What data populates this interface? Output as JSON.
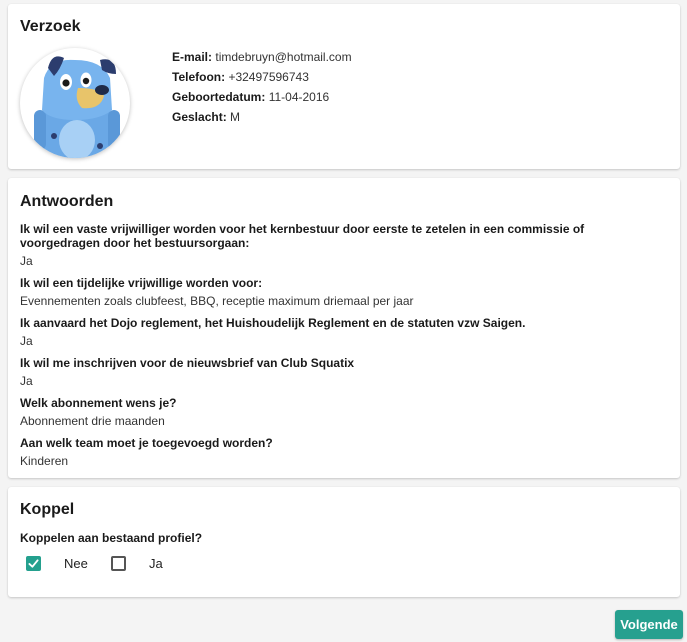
{
  "request": {
    "title": "Verzoek",
    "email_label": "E-mail:",
    "email": "timdebruyn@hotmail.com",
    "phone_label": "Telefoon:",
    "phone": "+32497596743",
    "birthdate_label": "Geboortedatum:",
    "birthdate": "11-04-2016",
    "gender_label": "Geslacht:",
    "gender": "M"
  },
  "answers": {
    "title": "Antwoorden",
    "items": [
      {
        "question": "Ik wil een vaste vrijwilliger worden voor het kernbestuur door eerste te zetelen in een commissie of voorgedragen door het bestuursorgaan:",
        "answer": "Ja"
      },
      {
        "question": "Ik wil een tijdelijke vrijwillige worden voor:",
        "answer": "Evennementen zoals clubfeest, BBQ, receptie maximum driemaal per jaar"
      },
      {
        "question": "Ik aanvaard het Dojo reglement, het Huishoudelijk Reglement en de statuten vzw Saigen.",
        "answer": "Ja"
      },
      {
        "question": "Ik wil me inschrijven voor de nieuwsbrief van Club Squatix",
        "answer": "Ja"
      },
      {
        "question": "Welk abonnement wens je?",
        "answer": "Abonnement drie maanden"
      },
      {
        "question": "Aan welk team moet je toegevoegd worden?",
        "answer": "Kinderen"
      }
    ]
  },
  "link": {
    "title": "Koppel",
    "question": "Koppelen aan bestaand profiel?",
    "options": [
      {
        "label": "Nee",
        "checked": true
      },
      {
        "label": "Ja",
        "checked": false
      }
    ]
  },
  "actions": {
    "next_label": "Volgende"
  },
  "colors": {
    "accent": "#26a08f",
    "avatar_blue": "#6aa8e6",
    "avatar_dark": "#2c3d6e"
  }
}
